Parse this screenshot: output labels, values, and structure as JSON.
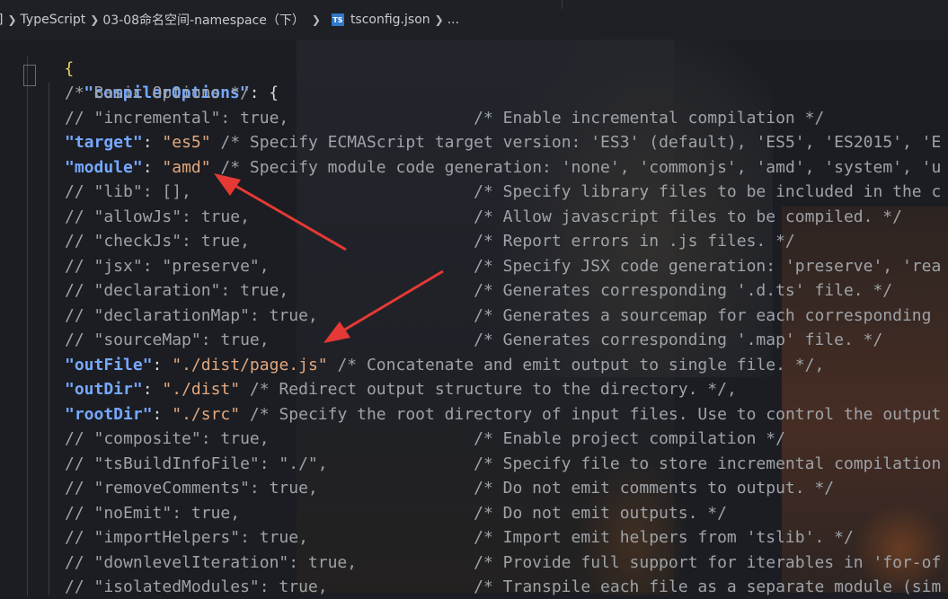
{
  "breadcrumb": {
    "items": [
      "]",
      "TypeScript",
      "03-08命名空间-namespace（下）",
      "tsconfig.json",
      "..."
    ],
    "file_icon_text": "TS"
  },
  "code": {
    "open_brace": "{",
    "compiler_options_key": "\"compilerOptions\"",
    "compiler_options_rest": ": {",
    "lines": [
      {
        "type": "comment",
        "text": "/* Basic Options */"
      },
      {
        "type": "commented",
        "text": "// \"incremental\": true,                   /* Enable incremental compilation */"
      },
      {
        "type": "active",
        "key": "\"target\"",
        "colon": ": ",
        "value": "\"es5\"",
        "comment": " /* Specify ECMAScript target version: 'ES3' (default), 'ES5', 'ES2015', 'E"
      },
      {
        "type": "active",
        "key": "\"module\"",
        "colon": ": ",
        "value": "\"amd\"",
        "comment": " /* Specify module code generation: 'none', 'commonjs', 'amd', 'system', 'u"
      },
      {
        "type": "commented",
        "text": "// \"lib\": [],                             /* Specify library files to be included in the c"
      },
      {
        "type": "commented",
        "text": "// \"allowJs\": true,                       /* Allow javascript files to be compiled. */"
      },
      {
        "type": "commented",
        "text": "// \"checkJs\": true,                       /* Report errors in .js files. */"
      },
      {
        "type": "commented",
        "text": "// \"jsx\": \"preserve\",                     /* Specify JSX code generation: 'preserve', 'rea"
      },
      {
        "type": "commented",
        "text": "// \"declaration\": true,                   /* Generates corresponding '.d.ts' file. */"
      },
      {
        "type": "commented",
        "text": "// \"declarationMap\": true,                /* Generates a sourcemap for each corresponding"
      },
      {
        "type": "commented",
        "text": "// \"sourceMap\": true,                     /* Generates corresponding '.map' file. */"
      },
      {
        "type": "active",
        "key": "\"outFile\"",
        "colon": ": ",
        "value": "\"./dist/page.js\"",
        "comment": " /* Concatenate and emit output to single file. */,"
      },
      {
        "type": "active",
        "key": "\"outDir\"",
        "colon": ": ",
        "value": "\"./dist\"",
        "comment": " /* Redirect output structure to the directory. */,"
      },
      {
        "type": "active",
        "key": "\"rootDir\"",
        "colon": ": ",
        "value": "\"./src\"",
        "comment": " /* Specify the root directory of input files. Use to control the output"
      },
      {
        "type": "commented",
        "text": "// \"composite\": true,                     /* Enable project compilation */"
      },
      {
        "type": "commented",
        "text": "// \"tsBuildInfoFile\": \"./\",               /* Specify file to store incremental compilation"
      },
      {
        "type": "commented",
        "text": "// \"removeComments\": true,                /* Do not emit comments to output. */"
      },
      {
        "type": "commented",
        "text": "// \"noEmit\": true,                        /* Do not emit outputs. */"
      },
      {
        "type": "commented",
        "text": "// \"importHelpers\": true,                 /* Import emit helpers from 'tslib'. */"
      },
      {
        "type": "commented",
        "text": "// \"downlevelIteration\": true,            /* Provide full support for iterables in 'for-of"
      },
      {
        "type": "commented",
        "text": "// \"isolatedModules\": true,               /* Transpile each file as a separate module (sim"
      }
    ]
  },
  "colors": {
    "background": "#1b1d22",
    "key": "#76a8ff",
    "string": "#e3a77d",
    "comment": "#9ea3a8",
    "brace": "#e8d46a",
    "arrow": "#e53935"
  }
}
